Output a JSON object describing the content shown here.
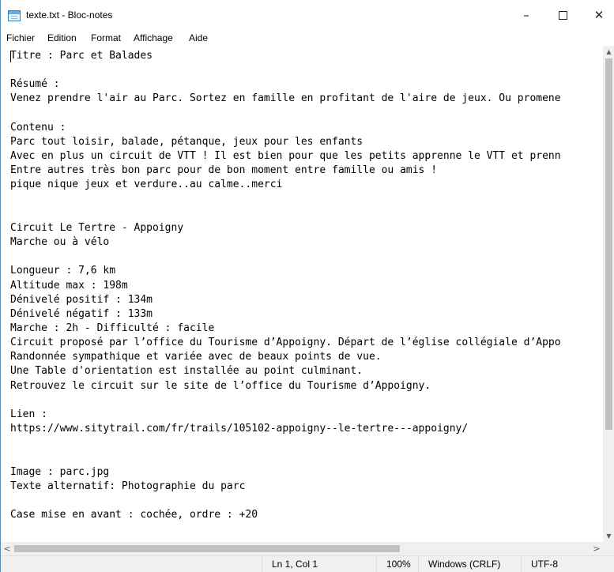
{
  "window": {
    "title": "texte.txt - Bloc-notes",
    "controls": {
      "minimize": "–",
      "close": "✕"
    }
  },
  "menu": {
    "items": [
      {
        "label": "Fichier"
      },
      {
        "label": "Edition"
      },
      {
        "label": "Format"
      },
      {
        "label": "Affichage"
      },
      {
        "label": "Aide"
      }
    ]
  },
  "document": {
    "lines": [
      "Titre : Parc et Balades",
      "",
      "Résumé :",
      "Venez prendre l'air au Parc. Sortez en famille en profitant de l'aire de jeux. Ou promene",
      "",
      "Contenu :",
      "Parc tout loisir, balade, pétanque, jeux pour les enfants",
      "Avec en plus un circuit de VTT ! Il est bien pour que les petits apprenne le VTT et prenn",
      "Entre autres très bon parc pour de bon moment entre famille ou amis !",
      "pique nique jeux et verdure..au calme..merci",
      "",
      "",
      "Circuit Le Tertre - Appoigny",
      "Marche ou à vélo",
      "",
      "Longueur : 7,6 km",
      "Altitude max : 198m",
      "Dénivelé positif : 134m",
      "Dénivelé négatif : 133m",
      "Marche : 2h - Difficulté : facile",
      "Circuit proposé par l’office du Tourisme d’Appoigny. Départ de l’église collégiale d’Appo",
      "Randonnée sympathique et variée avec de beaux points de vue.",
      "Une Table d'orientation est installée au point culminant.",
      "Retrouvez le circuit sur le site de l’office du Tourisme d’Appoigny.",
      "",
      "Lien :",
      "https://www.sitytrail.com/fr/trails/105102-appoigny--le-tertre---appoigny/",
      "",
      "",
      "Image : parc.jpg",
      "Texte alternatif: Photographie du parc",
      "",
      "Case mise en avant : cochée, ordre : +20"
    ]
  },
  "scrollbars": {
    "up_arrow": "▲",
    "down_arrow": "▼",
    "left_arrow": "<",
    "right_arrow": ">"
  },
  "status": {
    "position": "Ln 1, Col 1",
    "zoom": "100%",
    "line_endings": "Windows (CRLF)",
    "encoding": "UTF-8"
  }
}
